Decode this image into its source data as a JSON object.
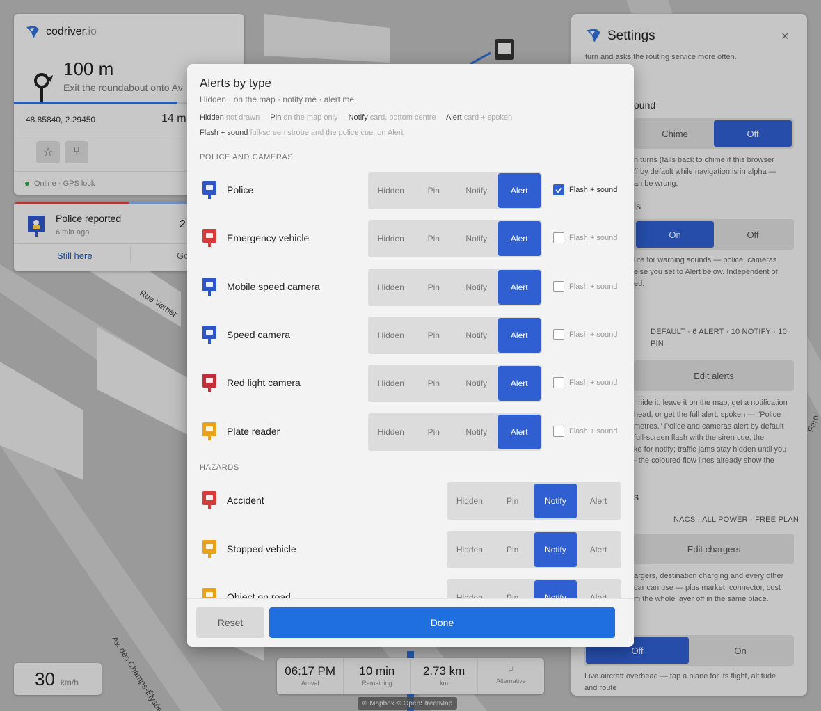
{
  "map": {
    "streets": [
      "Rue Vernet",
      "Av. des Champs-Élysées",
      "Fero"
    ]
  },
  "nav": {
    "brand_name": "codriver",
    "brand_suffix": ".io",
    "distance": "100 m",
    "instruction": "Exit the roundabout onto Av",
    "route_progress": 0.71,
    "coords": "48.85840, 2.29450",
    "eta_partial": "14 m",
    "status": "Online · GPS lock"
  },
  "report": {
    "title": "Police reported",
    "age": "6 min ago",
    "count_partial": "2",
    "still_here": "Still here",
    "gone_partial": "Go"
  },
  "speed": {
    "value": "30",
    "unit": "km/h"
  },
  "trip": {
    "arrival": {
      "value": "06:17 PM",
      "label": "Arrival"
    },
    "remaining": {
      "value": "10 min",
      "label": "Remaining"
    },
    "distance": {
      "value": "2.73 km",
      "label": "km"
    },
    "alternative_label": "Alternative"
  },
  "attribution": "© Mapbox © OpenStreetMap",
  "settings": {
    "title": "Settings",
    "close": "×",
    "top_text": "turn and asks the routing service more often.",
    "sound_heading": "ound",
    "sound_options": [
      "Chime",
      "Off"
    ],
    "sound_text_1": "n turns (falls back to chime if this browser",
    "sound_text_2": "ff by default while navigation is in alpha —",
    "sound_text_3": "an be wrong.",
    "alerts_heading": "ls",
    "alert_options": [
      "On",
      "Off"
    ],
    "alert_text_1": "ute for warning sounds — police, cameras",
    "alert_text_2": "else you set to Alert below. Independent of",
    "alert_text_3": "ed.",
    "alerts_meta_1": "DEFAULT · 6 ALERT · 10 NOTIFY · 10",
    "alerts_meta_2": "PIN",
    "edit_alerts": "Edit alerts",
    "edit_text_1": ": hide it, leave it on the map, get a notification",
    "edit_text_2": "head, or get the full alert, spoken — \"Police",
    "edit_text_3": "metres.\" Police and cameras alert by default",
    "edit_text_4": "full-screen flash with the siren cue; the",
    "edit_text_5": "ke for notify; traffic jams stay hidden until you",
    "edit_text_6": "- the coloured flow lines already show the",
    "chargers_heading": "s",
    "chargers_meta": "NACS · ALL POWER · FREE PLAN",
    "edit_chargers": "Edit chargers",
    "chargers_text_1": "argers, destination charging and every other",
    "chargers_text_2": "car can use — plus market, connector, cost",
    "chargers_text_3": "m the whole layer off in the same place.",
    "aircraft_options": [
      "Off",
      "On"
    ],
    "aircraft_text_1": "Live aircraft overhead — tap a plane for its flight, altitude",
    "aircraft_text_2": "and route"
  },
  "modal": {
    "title": "Alerts by type",
    "subtitle": "Hidden · on the map · notify me · alert me",
    "legend": {
      "hidden_term": "Hidden",
      "hidden_desc": "not drawn",
      "pin_term": "Pin",
      "pin_desc": "on the map only",
      "notify_term": "Notify",
      "notify_desc": "card, bottom centre",
      "alert_term": "Alert",
      "alert_desc": "card + spoken",
      "flash_term": "Flash + sound",
      "flash_desc": "full-screen strobe and the police cue, on Alert"
    },
    "mode_options": [
      "Hidden",
      "Pin",
      "Notify",
      "Alert"
    ],
    "flash_label": "Flash + sound",
    "section_police": "POLICE AND CAMERAS",
    "section_hazards": "HAZARDS",
    "police_rows": [
      {
        "label": "Police",
        "mode": "Alert",
        "flash": true,
        "icon": "police-icon",
        "color": "#2f55c9"
      },
      {
        "label": "Emergency vehicle",
        "mode": "Alert",
        "flash": false,
        "icon": "ambulance-icon",
        "color": "#d63a3a"
      },
      {
        "label": "Mobile speed camera",
        "mode": "Alert",
        "flash": false,
        "icon": "mobile-camera-icon",
        "color": "#2f55c9"
      },
      {
        "label": "Speed camera",
        "mode": "Alert",
        "flash": false,
        "icon": "speed-camera-icon",
        "color": "#2f55c9"
      },
      {
        "label": "Red light camera",
        "mode": "Alert",
        "flash": false,
        "icon": "red-light-camera-icon",
        "color": "#c0303a"
      },
      {
        "label": "Plate reader",
        "mode": "Alert",
        "flash": false,
        "icon": "plate-reader-icon",
        "color": "#e9a21c"
      }
    ],
    "hazard_rows": [
      {
        "label": "Accident",
        "mode": "Notify",
        "icon": "accident-icon",
        "color": "#d63a3a"
      },
      {
        "label": "Stopped vehicle",
        "mode": "Notify",
        "icon": "stopped-vehicle-icon",
        "color": "#e9a21c"
      },
      {
        "label": "Object on road",
        "mode": "Notify",
        "icon": "object-on-road-icon",
        "color": "#e9a21c"
      }
    ],
    "reset": "Reset",
    "done": "Done"
  },
  "colors": {
    "accent": "#2f5fd0",
    "done": "#1f6fe0",
    "report_red": "#c94a4a"
  }
}
